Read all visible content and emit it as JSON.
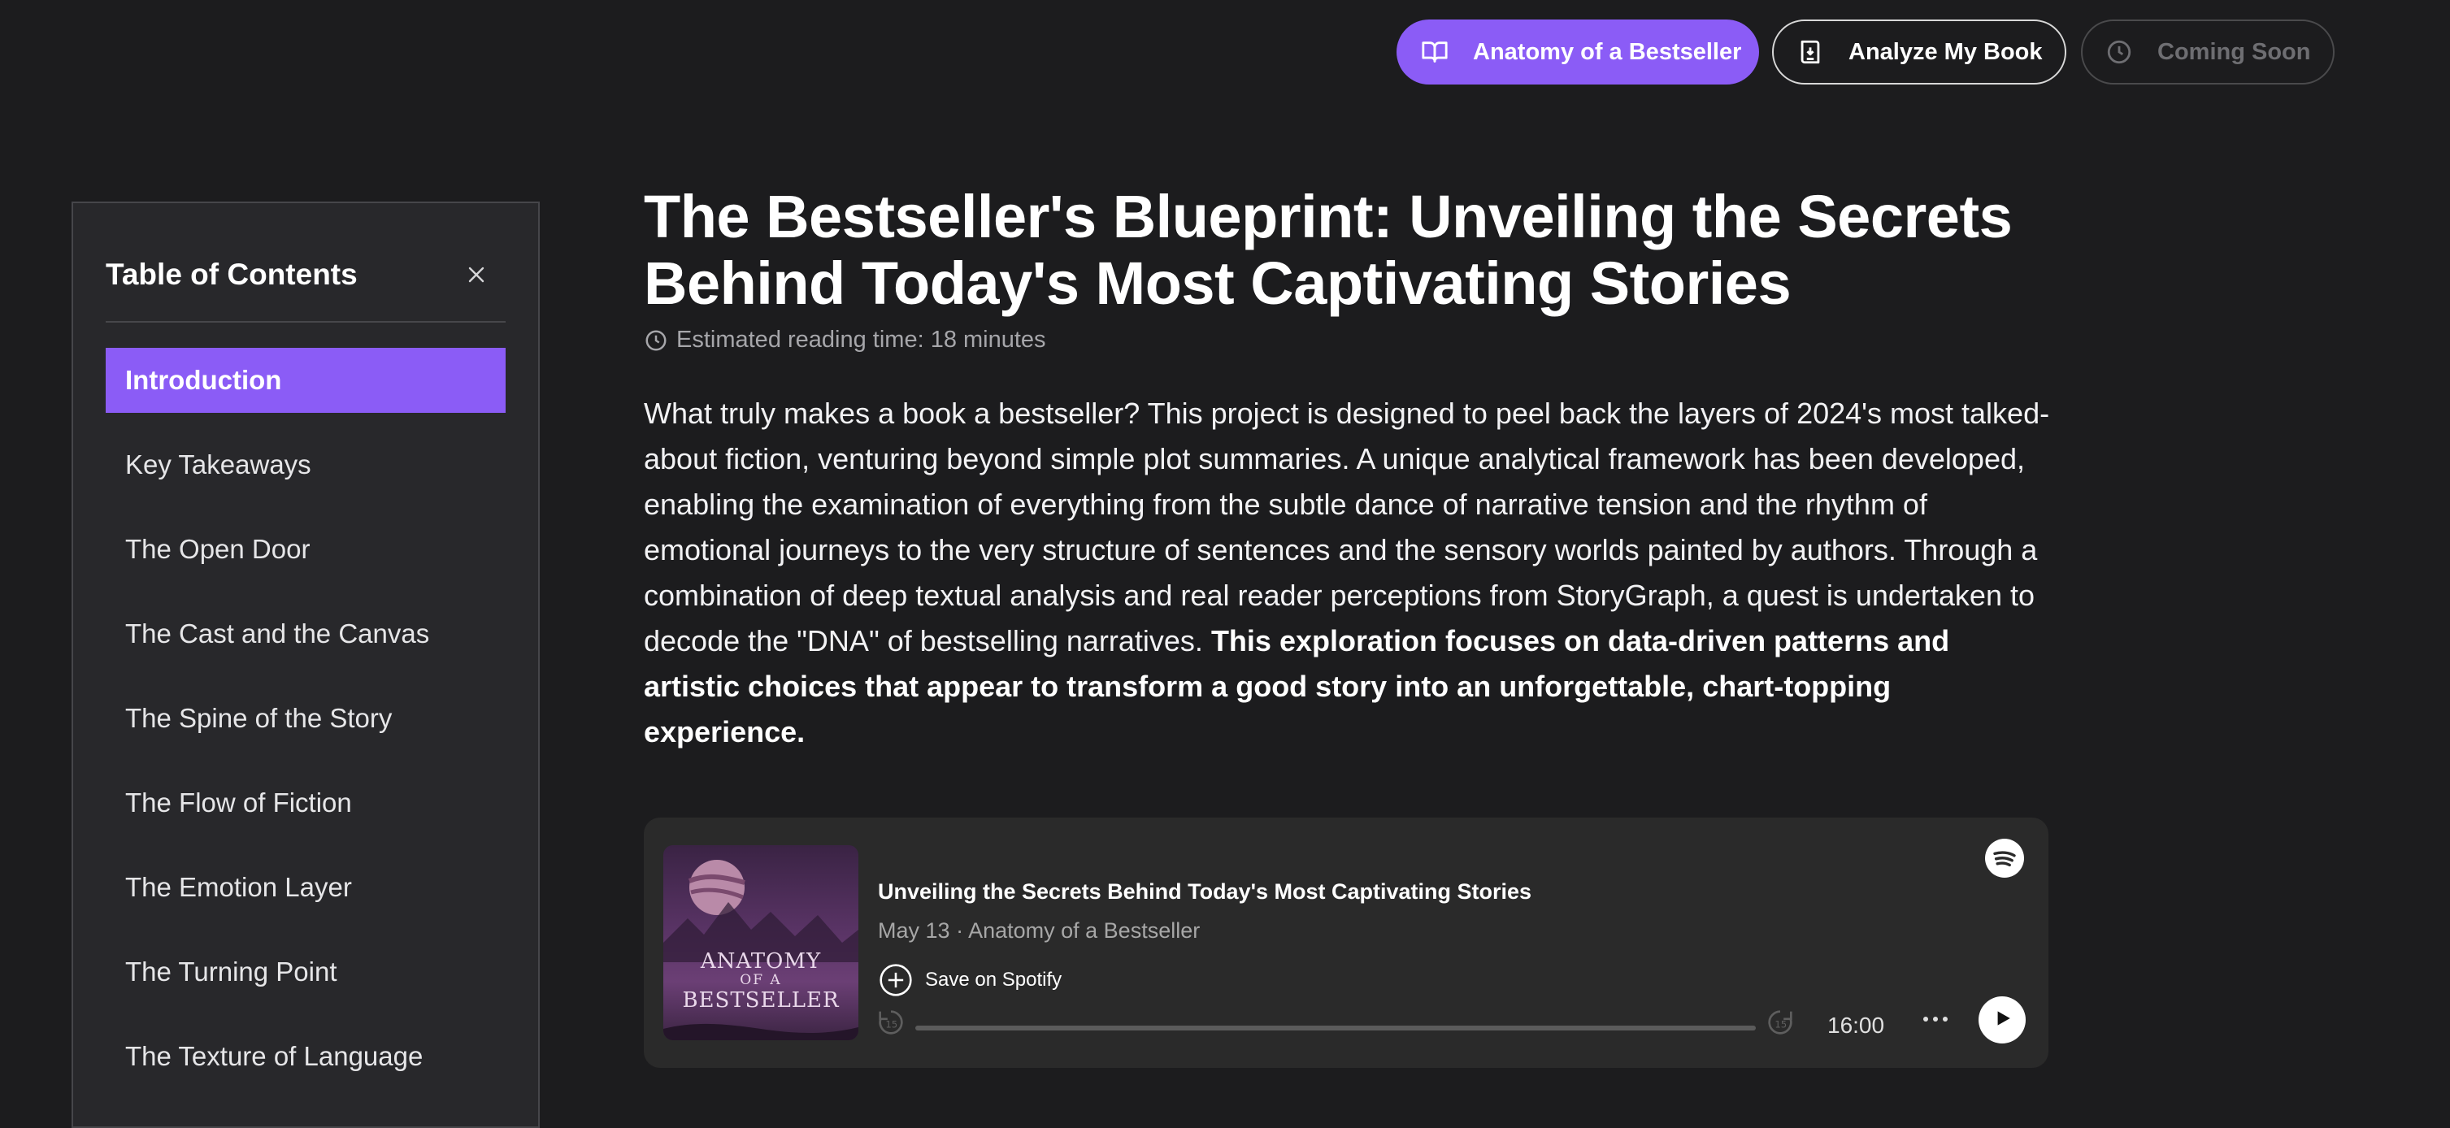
{
  "nav": {
    "buttons": [
      {
        "label": "Anatomy of a Bestseller",
        "icon": "book-open-icon",
        "active": true
      },
      {
        "label": "Analyze My Book",
        "icon": "book-download-icon",
        "active": false
      },
      {
        "label": "Coming Soon",
        "icon": "clock-icon",
        "disabled": true
      }
    ]
  },
  "toc": {
    "title": "Table of Contents",
    "close_icon": "close-icon",
    "items": [
      {
        "label": "Introduction",
        "active": true
      },
      {
        "label": "Key Takeaways"
      },
      {
        "label": "The Open Door"
      },
      {
        "label": "The Cast and the Canvas"
      },
      {
        "label": "The Spine of the Story"
      },
      {
        "label": "The Flow of Fiction"
      },
      {
        "label": "The Emotion Layer"
      },
      {
        "label": "The Turning Point"
      },
      {
        "label": "The Texture of Language"
      }
    ]
  },
  "article": {
    "title": "The Bestseller's Blueprint: Unveiling the Secrets Behind Today's Most Captivating Stories",
    "reading_time": "Estimated reading time: 18 minutes",
    "intro": "What truly makes a book a bestseller? This project is designed to peel back the layers of 2024's most talked-about fiction, venturing beyond simple plot summaries. A unique analytical framework has been developed, enabling the examination of everything from the subtle dance of narrative tension and the rhythm of emotional journeys to the very structure of sentences and the sensory worlds painted by authors. Through a combination of deep textual analysis and real reader perceptions from StoryGraph, a quest is undertaken to decode the \"DNA\" of bestselling narratives.",
    "intro_bold": "This exploration focuses on data-driven patterns and artistic choices that appear to transform a good story into an unforgettable, chart-topping experience."
  },
  "player": {
    "episode_title": "Unveiling the Secrets Behind Today's Most Captivating Stories",
    "date": "May 13",
    "separator": "·",
    "show": "Anatomy of a Bestseller",
    "save_label": "Save on Spotify",
    "duration": "16:00",
    "progress": 0,
    "cover_line1": "ANATOMY",
    "cover_line2": "OF A",
    "cover_line3": "BESTSELLER",
    "colors": {
      "accent": "#8b5cf6",
      "background": "#1c1c1e",
      "player_bg": "#2a2a2a"
    }
  }
}
